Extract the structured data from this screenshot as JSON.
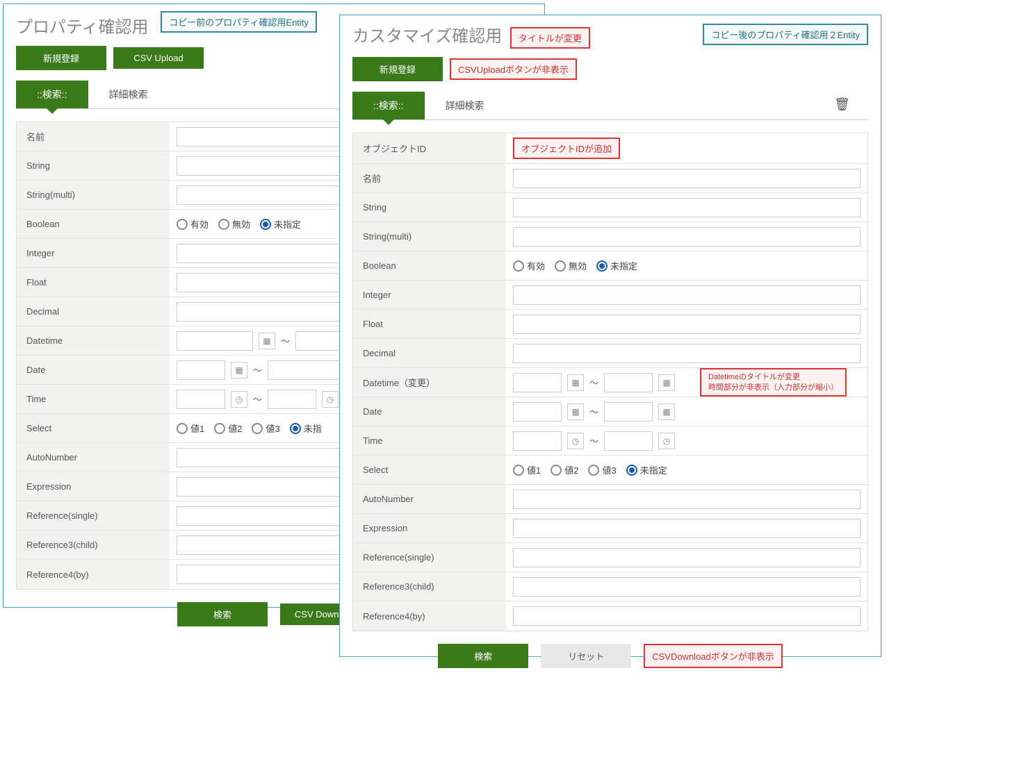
{
  "colors": {
    "primary": "#3b7a1a",
    "accent_teal": "#2a8aa8",
    "accent_red": "#d33"
  },
  "left": {
    "title": "プロパティ確認用",
    "title_note": "コピー前のプロパティ確認用Entity",
    "buttons": {
      "new": "新規登録",
      "csv_upload": "CSV Upload"
    },
    "tabs": {
      "search": "::検索::",
      "advanced": "詳細検索"
    },
    "fields": {
      "name": "名前",
      "string": "String",
      "string_multi": "String(multi)",
      "boolean": "Boolean",
      "integer": "Integer",
      "float": "Float",
      "decimal": "Decimal",
      "datetime": "Datetime",
      "date": "Date",
      "time": "Time",
      "select": "Select",
      "autonumber": "AutoNumber",
      "expression": "Expression",
      "ref_single": "Reference(single)",
      "ref3_child": "Reference3(child)",
      "ref4_by": "Reference4(by)"
    },
    "boolean_opts": {
      "valid": "有効",
      "invalid": "無効",
      "unspecified": "未指定"
    },
    "select_opts": {
      "v1": "値1",
      "v2": "値2",
      "v3": "値3",
      "unspecified": "未指"
    },
    "range_sep": "～",
    "footer": {
      "search": "検索",
      "csv_download": "CSV Download"
    }
  },
  "right": {
    "title": "カスタマイズ確認用",
    "title_change_note": "タイトルが変更",
    "title_copy_note": "コピー後のプロパティ確認用２Entity",
    "buttons": {
      "new": "新規登録"
    },
    "csv_upload_hidden_note": "CSVUploadボタンが非表示",
    "tabs": {
      "search": "::検索::",
      "advanced": "詳細検索"
    },
    "fields": {
      "object_id": "オブジェクトID",
      "object_id_note": "オブジェクトIDが追加",
      "name": "名前",
      "string": "String",
      "string_multi": "String(multi)",
      "boolean": "Boolean",
      "integer": "Integer",
      "float": "Float",
      "decimal": "Decimal",
      "datetime": "Datetime（変更）",
      "datetime_note": "Datetimeのタイトルが変更\n時間部分が非表示（入力部分が縮小）",
      "date": "Date",
      "time": "Time",
      "select": "Select",
      "autonumber": "AutoNumber",
      "expression": "Expression",
      "ref_single": "Reference(single)",
      "ref3_child": "Reference3(child)",
      "ref4_by": "Reference4(by)"
    },
    "boolean_opts": {
      "valid": "有効",
      "invalid": "無効",
      "unspecified": "未指定"
    },
    "select_opts": {
      "v1": "値1",
      "v2": "値2",
      "v3": "値3",
      "unspecified": "未指定"
    },
    "range_sep": "～",
    "footer": {
      "search": "検索",
      "reset": "リセット",
      "csv_download_hidden_note": "CSVDownloadボタンが非表示"
    }
  }
}
